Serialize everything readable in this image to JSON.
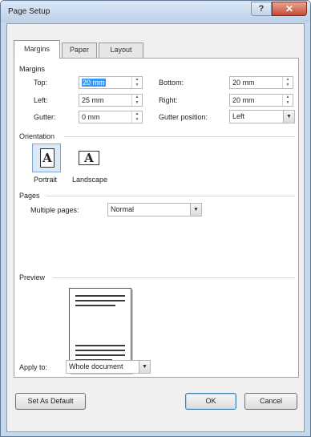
{
  "window": {
    "title": "Page Setup",
    "help_glyph": "?",
    "close_glyph": "✕"
  },
  "tabs": [
    {
      "label": "Margins"
    },
    {
      "label": "Paper"
    },
    {
      "label": "Layout"
    }
  ],
  "margins": {
    "section_title": "Margins",
    "top": {
      "label": "Top:",
      "value": "20 mm"
    },
    "bottom": {
      "label": "Bottom:",
      "value": "20 mm"
    },
    "left": {
      "label": "Left:",
      "value": "25 mm"
    },
    "right": {
      "label": "Right:",
      "value": "20 mm"
    },
    "gutter": {
      "label": "Gutter:",
      "value": "0 mm"
    },
    "gutter_position": {
      "label": "Gutter position:",
      "value": "Left"
    }
  },
  "orientation": {
    "section_title": "Orientation",
    "portrait": {
      "label": "Portrait",
      "selected": true
    },
    "landscape": {
      "label": "Landscape",
      "selected": false
    }
  },
  "pages": {
    "section_title": "Pages",
    "multiple_pages": {
      "label": "Multiple pages:",
      "value": "Normal"
    }
  },
  "preview": {
    "section_title": "Preview"
  },
  "apply_to": {
    "label": "Apply to:",
    "value": "Whole document"
  },
  "footer": {
    "set_default_label": "Set As Default",
    "ok_label": "OK",
    "cancel_label": "Cancel"
  },
  "colors": {
    "frame": "#c6d8ec",
    "selection": "#3399ff",
    "close_button": "#c54a35"
  },
  "icons": {
    "help": "help-icon",
    "close": "close-icon",
    "spin": "spin-arrows-icon",
    "dropdown": "chevron-down-icon",
    "portrait": "portrait-page-icon",
    "landscape": "landscape-page-icon"
  }
}
